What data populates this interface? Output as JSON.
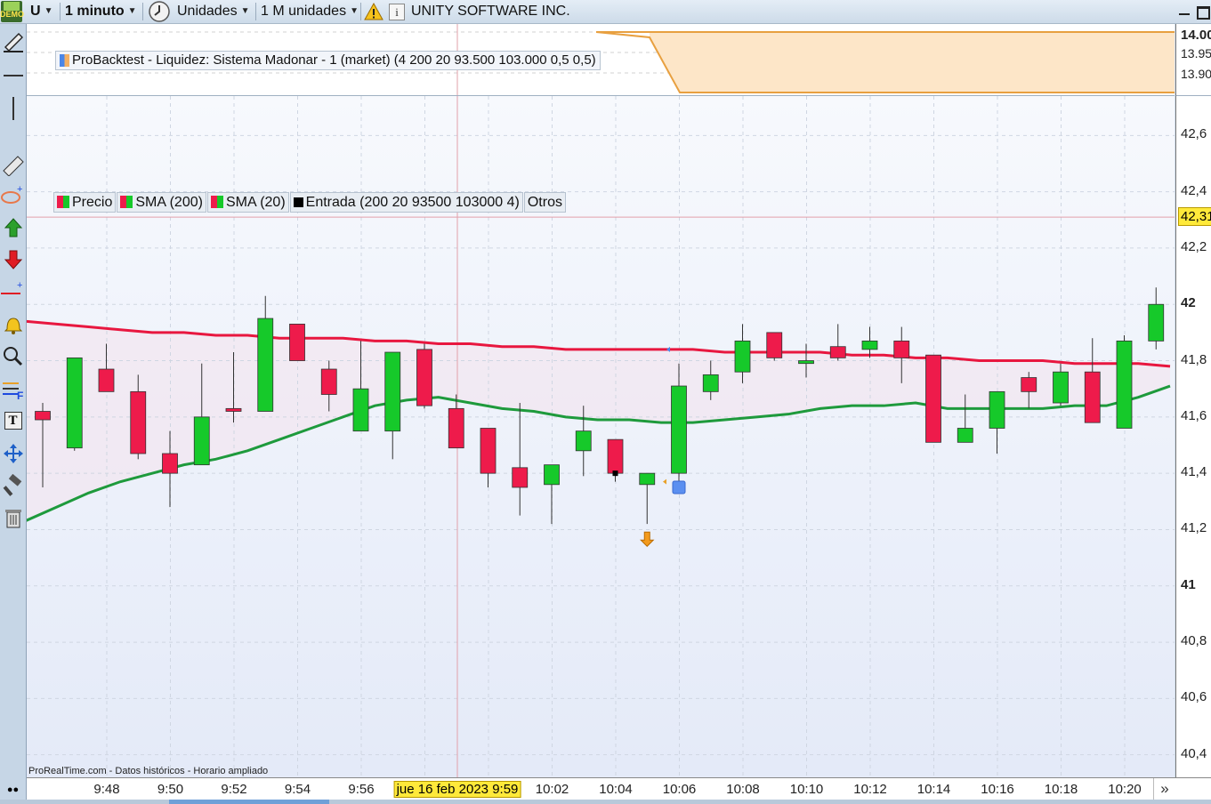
{
  "toolbar": {
    "demo_badge": "DEMO",
    "symbol": "U",
    "timeframe": "1 minuto",
    "units": "Unidades",
    "bar_count": "1 M unidades",
    "company": "UNITY SOFTWARE INC."
  },
  "backtest": {
    "legend": "ProBacktest - Liquidez: Sistema Madonar - 1 (market) (4 200 20 93.500 103.000 0,5 0,5)",
    "y_labels": [
      "14.00",
      "13.95",
      "13.90"
    ]
  },
  "legend": {
    "items": [
      "Precio",
      "SMA (200)",
      "SMA (20)",
      "Entrada (200 20 93500 103000 4)"
    ],
    "others": "Otros"
  },
  "price_axis": {
    "labels": [
      "42,6",
      "42,4",
      "42,2",
      "42",
      "41,8",
      "41,6",
      "41,4",
      "41,2",
      "41",
      "40,8",
      "40,6",
      "40,4"
    ],
    "current_price": "42,31"
  },
  "time_axis": {
    "labels": [
      "9:48",
      "9:50",
      "9:52",
      "9:54",
      "9:56",
      "10:02",
      "10:04",
      "10:06",
      "10:08",
      "10:10",
      "10:12",
      "10:14",
      "10:16",
      "10:18",
      "10:20"
    ],
    "cursor_label": "jue 16 feb 2023 9:59"
  },
  "footer_note": "ProRealTime.com - Datos históricos - Horario ampliado",
  "colors": {
    "up": "#16c92a",
    "down": "#ee1b4b",
    "sma200": "#e8173f",
    "sma20": "#1e9a3c",
    "crosshair": "#e2a0aa",
    "current_price_bg": "#ffe93a"
  },
  "chart_data": {
    "type": "candlestick",
    "title": "UNITY SOFTWARE INC.",
    "xlabel": "",
    "ylabel": "",
    "ylim": [
      40.32,
      42.74
    ],
    "x": [
      "9:47",
      "9:48",
      "9:49",
      "9:50",
      "9:51",
      "9:52",
      "9:53",
      "9:54",
      "9:55",
      "9:56",
      "9:57",
      "9:58",
      "9:59",
      "10:00",
      "10:01",
      "10:02",
      "10:03",
      "10:04",
      "10:05",
      "10:06",
      "10:07",
      "10:08",
      "10:09",
      "10:10",
      "10:11",
      "10:12",
      "10:13",
      "10:14",
      "10:15",
      "10:16",
      "10:17",
      "10:18",
      "10:19",
      "10:20",
      "10:21"
    ],
    "series": [
      {
        "name": "Precio",
        "type": "candlestick",
        "ohlc": [
          [
            41.62,
            41.65,
            41.35,
            41.59
          ],
          [
            41.49,
            41.81,
            41.48,
            41.81
          ],
          [
            41.77,
            41.86,
            41.69,
            41.69
          ],
          [
            41.69,
            41.75,
            41.45,
            41.47
          ],
          [
            41.47,
            41.55,
            41.28,
            41.4
          ],
          [
            41.43,
            41.79,
            41.43,
            41.6
          ],
          [
            41.63,
            41.83,
            41.58,
            41.62
          ],
          [
            41.62,
            42.03,
            41.62,
            41.95
          ],
          [
            41.93,
            41.93,
            41.8,
            41.8
          ],
          [
            41.77,
            41.8,
            41.62,
            41.68
          ],
          [
            41.55,
            41.87,
            41.55,
            41.7
          ],
          [
            41.55,
            41.83,
            41.45,
            41.83
          ],
          [
            41.84,
            41.86,
            41.63,
            41.64
          ],
          [
            41.63,
            41.68,
            41.49,
            41.49
          ],
          [
            41.56,
            41.56,
            41.35,
            41.4
          ],
          [
            41.42,
            41.65,
            41.25,
            41.35
          ],
          [
            41.36,
            41.43,
            41.22,
            41.43
          ],
          [
            41.48,
            41.64,
            41.39,
            41.55
          ],
          [
            41.52,
            41.52,
            41.37,
            41.4
          ],
          [
            41.36,
            41.4,
            41.22,
            41.4
          ],
          [
            41.4,
            41.79,
            41.35,
            41.71
          ],
          [
            41.69,
            41.8,
            41.66,
            41.75
          ],
          [
            41.76,
            41.93,
            41.72,
            41.87
          ],
          [
            41.9,
            41.9,
            41.8,
            41.81
          ],
          [
            41.79,
            41.86,
            41.74,
            41.8
          ],
          [
            41.85,
            41.93,
            41.8,
            41.81
          ],
          [
            41.84,
            41.92,
            41.81,
            41.87
          ],
          [
            41.87,
            41.92,
            41.72,
            41.81
          ],
          [
            41.82,
            41.82,
            41.51,
            41.51
          ],
          [
            41.51,
            41.68,
            41.51,
            41.56
          ],
          [
            41.56,
            41.69,
            41.47,
            41.69
          ],
          [
            41.74,
            41.76,
            41.63,
            41.69
          ],
          [
            41.65,
            41.79,
            41.64,
            41.76
          ],
          [
            41.76,
            41.88,
            41.58,
            41.58
          ],
          [
            41.56,
            41.89,
            41.56,
            41.87
          ],
          [
            41.87,
            42.06,
            41.84,
            42.0
          ]
        ]
      },
      {
        "name": "SMA (200)",
        "type": "line",
        "values": [
          41.94,
          41.93,
          41.92,
          41.91,
          41.9,
          41.9,
          41.89,
          41.89,
          41.88,
          41.88,
          41.88,
          41.87,
          41.87,
          41.86,
          41.86,
          41.85,
          41.85,
          41.84,
          41.84,
          41.84,
          41.84,
          41.84,
          41.83,
          41.83,
          41.83,
          41.83,
          41.82,
          41.82,
          41.81,
          41.81,
          41.8,
          41.8,
          41.8,
          41.79,
          41.79,
          41.79,
          41.78
        ]
      },
      {
        "name": "SMA (20)",
        "type": "line",
        "values": [
          41.23,
          41.28,
          41.33,
          41.37,
          41.4,
          41.43,
          41.45,
          41.48,
          41.52,
          41.56,
          41.6,
          41.64,
          41.66,
          41.67,
          41.65,
          41.63,
          41.62,
          41.6,
          41.59,
          41.59,
          41.58,
          41.58,
          41.59,
          41.6,
          41.61,
          41.63,
          41.64,
          41.64,
          41.65,
          41.63,
          41.63,
          41.63,
          41.63,
          41.64,
          41.64,
          41.67,
          41.71
        ]
      }
    ],
    "gridlines": true,
    "crosshair": {
      "x": "9:59",
      "y": 42.31
    }
  }
}
